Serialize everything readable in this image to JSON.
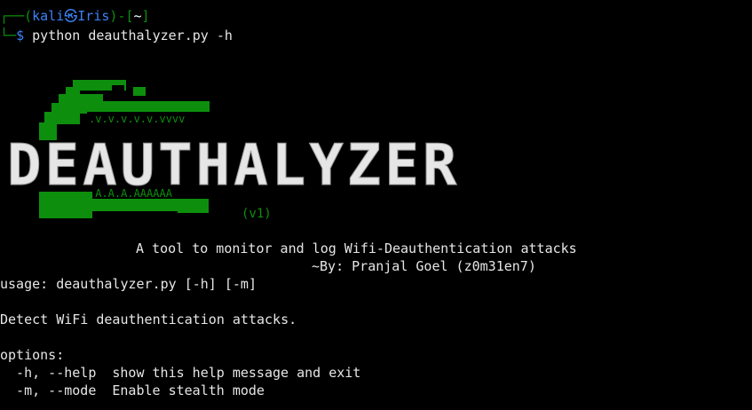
{
  "prompt": {
    "corner_top": "┌──(",
    "user": "kali",
    "at": "㉿",
    "host": "Iris",
    "sep": ")-[",
    "dir": "~",
    "close": "]",
    "corner_bottom": "└─",
    "dollar": "$",
    "command": " python deauthalyzer.py -h"
  },
  "banner": {
    "logo_text": "DEAUTHALYZER",
    "teeth_top": ".v.v.v.v.v.vvvv",
    "teeth_bottom": ".A.A.A.AAAAAA",
    "version": "(v1)"
  },
  "output": {
    "tagline": "A tool to monitor and log Wifi-Deauthentication attacks",
    "author": "~By: Pranjal Goel (z0m31en7)",
    "usage": "usage: deauthalyzer.py [-h] [-m]",
    "description": "Detect WiFi deauthentication attacks.",
    "options_header": "options:",
    "options": [
      {
        "flag": "  -h, --help",
        "desc": "show this help message and exit"
      },
      {
        "flag": "  -m, --mode",
        "desc": "Enable stealth mode"
      }
    ]
  },
  "colors": {
    "background": "#000000",
    "green": "#0d8f0d",
    "prompt_blue": "#3b82f6",
    "text": "#e6e6e6"
  }
}
